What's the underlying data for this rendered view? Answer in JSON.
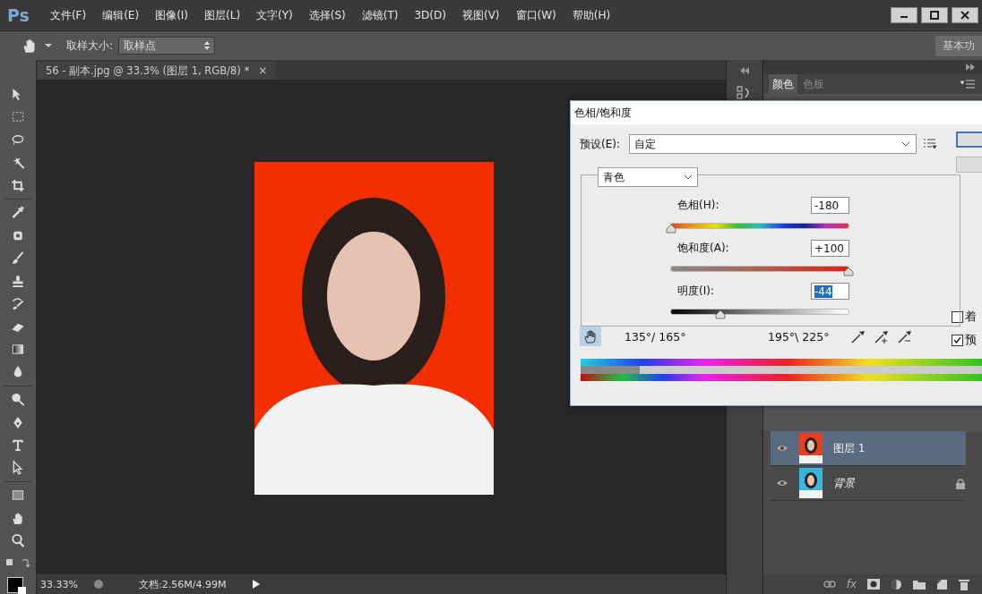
{
  "app": {
    "logo": "Ps"
  },
  "menu": [
    "文件(F)",
    "编辑(E)",
    "图像(I)",
    "图层(L)",
    "文字(Y)",
    "选择(S)",
    "滤镜(T)",
    "3D(D)",
    "视图(V)",
    "窗口(W)",
    "帮助(H)"
  ],
  "options_bar": {
    "sample_size_label": "取样大小:",
    "sample_size_value": "取样点",
    "workspace": "基本功"
  },
  "document_tab": {
    "title": "56 - 副本.jpg @ 33.3% (图层 1, RGB/8) *",
    "close": "×"
  },
  "status_bar": {
    "zoom": "33.33%",
    "doc_info": "文档:2.56M/4.99M"
  },
  "panel_tabs": [
    {
      "label": "颜色",
      "selected": true
    },
    {
      "label": "色板",
      "selected": false
    }
  ],
  "layers": [
    {
      "name": "图层 1",
      "selected": true,
      "visible": true,
      "locked": false,
      "color": "#e8401c"
    },
    {
      "name": "背景",
      "selected": false,
      "visible": true,
      "locked": true,
      "color": "#35b6dc"
    }
  ],
  "layers_footer": {
    "fx": "fx"
  },
  "dialog": {
    "title": "色相/饱和度",
    "preset_label": "预设(E):",
    "preset_value": "自定",
    "channel": "青色",
    "sliders": [
      {
        "kind": "hue",
        "label": "色相(H):",
        "value": "-180",
        "level": 0,
        "text_selected": false
      },
      {
        "kind": "saturation",
        "label": "饱和度(A):",
        "value": "+100",
        "level": 1,
        "text_selected": false
      },
      {
        "kind": "lightness",
        "label": "明度(I):",
        "value": "-44",
        "level": 0.28,
        "text_selected": true
      }
    ],
    "range_left": "135°/ 165°",
    "range_right": "195°\\ 225°",
    "checkboxes": [
      {
        "label": "着",
        "checked": false
      },
      {
        "label": "预",
        "checked": true
      }
    ]
  }
}
